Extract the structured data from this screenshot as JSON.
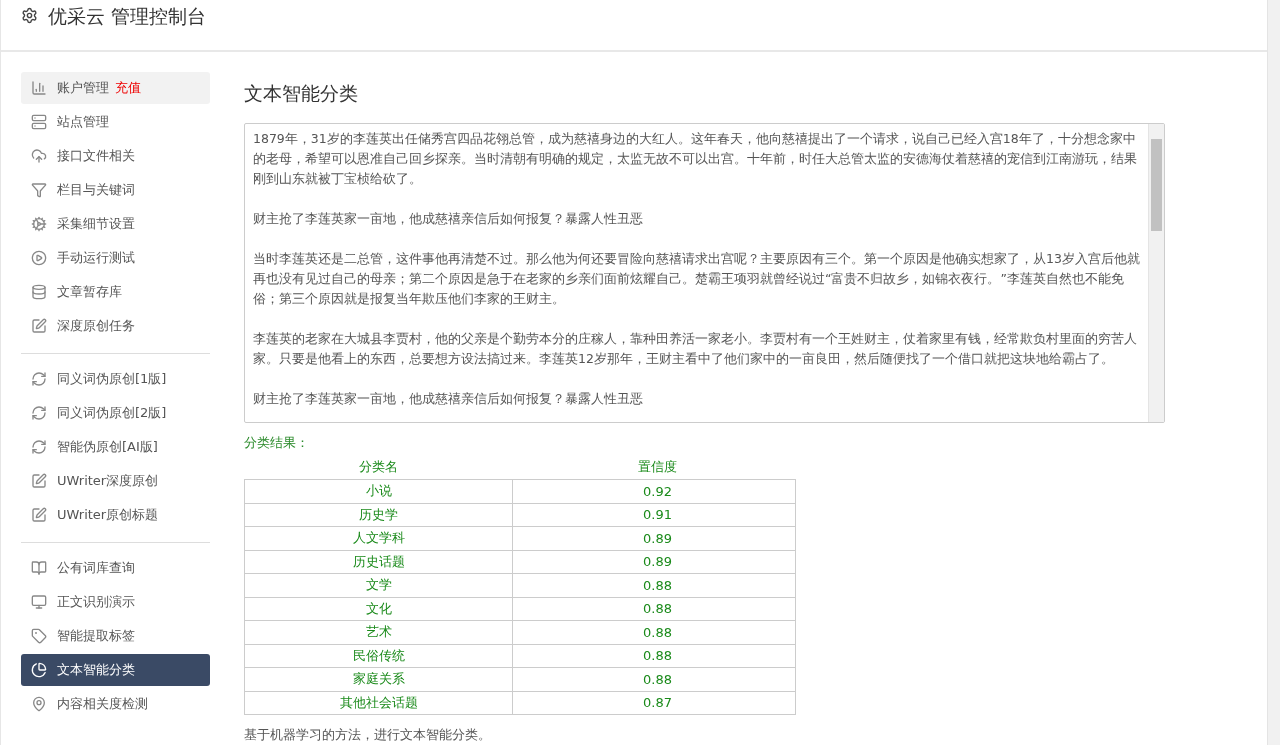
{
  "header": {
    "title": "优采云 管理控制台"
  },
  "sidebar": {
    "groups": [
      [
        {
          "label": "账户管理",
          "badge": "充值",
          "hovered": true,
          "selected": false
        },
        {
          "label": "站点管理",
          "hovered": false,
          "selected": false
        },
        {
          "label": "接口文件相关",
          "hovered": false,
          "selected": false
        },
        {
          "label": "栏目与关键词",
          "hovered": false,
          "selected": false
        },
        {
          "label": "采集细节设置",
          "hovered": false,
          "selected": false
        },
        {
          "label": "手动运行测试",
          "hovered": false,
          "selected": false
        },
        {
          "label": "文章暂存库",
          "hovered": false,
          "selected": false
        },
        {
          "label": "深度原创任务",
          "hovered": false,
          "selected": false
        }
      ],
      [
        {
          "label": "同义词伪原创[1版]",
          "hovered": false,
          "selected": false
        },
        {
          "label": "同义词伪原创[2版]",
          "hovered": false,
          "selected": false
        },
        {
          "label": "智能伪原创[AI版]",
          "hovered": false,
          "selected": false
        },
        {
          "label": "UWriter深度原创",
          "hovered": false,
          "selected": false
        },
        {
          "label": "UWriter原创标题",
          "hovered": false,
          "selected": false
        }
      ],
      [
        {
          "label": "公有词库查询",
          "hovered": false,
          "selected": false
        },
        {
          "label": "正文识别演示",
          "hovered": false,
          "selected": false
        },
        {
          "label": "智能提取标签",
          "hovered": false,
          "selected": false
        },
        {
          "label": "文本智能分类",
          "hovered": false,
          "selected": true
        },
        {
          "label": "内容相关度检测",
          "hovered": false,
          "selected": false
        }
      ]
    ]
  },
  "main": {
    "title": "文本智能分类",
    "article": [
      "1879年，31岁的李莲英出任储秀宫四品花翎总管，成为慈禧身边的大红人。这年春天，他向慈禧提出了一个请求，说自己已经入宫18年了，十分想念家中的老母，希望可以恩准自己回乡探亲。当时清朝有明确的规定，太监无故不可以出宫。十年前，时任大总管太监的安德海仗着慈禧的宠信到江南游玩，结果刚到山东就被丁宝桢给砍了。",
      "财主抢了李莲英家一亩地，他成慈禧亲信后如何报复？暴露人性丑恶",
      "当时李莲英还是二总管，这件事他再清楚不过。那么他为何还要冒险向慈禧请求出宫呢？主要原因有三个。第一个原因是他确实想家了，从13岁入宫后他就再也没有见过自己的母亲；第二个原因是急于在老家的乡亲们面前炫耀自己。楚霸王项羽就曾经说过“富贵不归故乡，如锦衣夜行。”李莲英自然也不能免俗；第三个原因就是报复当年欺压他们李家的王财主。",
      "李莲英的老家在大城县李贾村，他的父亲是个勤劳本分的庄稼人，靠种田养活一家老小。李贾村有一个王姓财主，仗着家里有钱，经常欺负村里面的穷苦人家。只要是他看上的东西，总要想方设法搞过来。李莲英12岁那年，王财主看中了他们家中的一亩良田，然后随便找了一个借口就把这块地给霸占了。",
      "财主抢了李莲英家一亩地，他成慈禧亲信后如何报复？暴露人性丑恶"
    ],
    "result_label": "分类结果：",
    "table": {
      "columns": [
        "分类名",
        "置信度"
      ],
      "rows": [
        [
          "小说",
          "0.92"
        ],
        [
          "历史学",
          "0.91"
        ],
        [
          "人文学科",
          "0.89"
        ],
        [
          "历史话题",
          "0.89"
        ],
        [
          "文学",
          "0.88"
        ],
        [
          "文化",
          "0.88"
        ],
        [
          "艺术",
          "0.88"
        ],
        [
          "民俗传统",
          "0.88"
        ],
        [
          "家庭关系",
          "0.88"
        ],
        [
          "其他社会话题",
          "0.87"
        ]
      ]
    },
    "note": "基于机器学习的方法，进行文本智能分类。"
  }
}
